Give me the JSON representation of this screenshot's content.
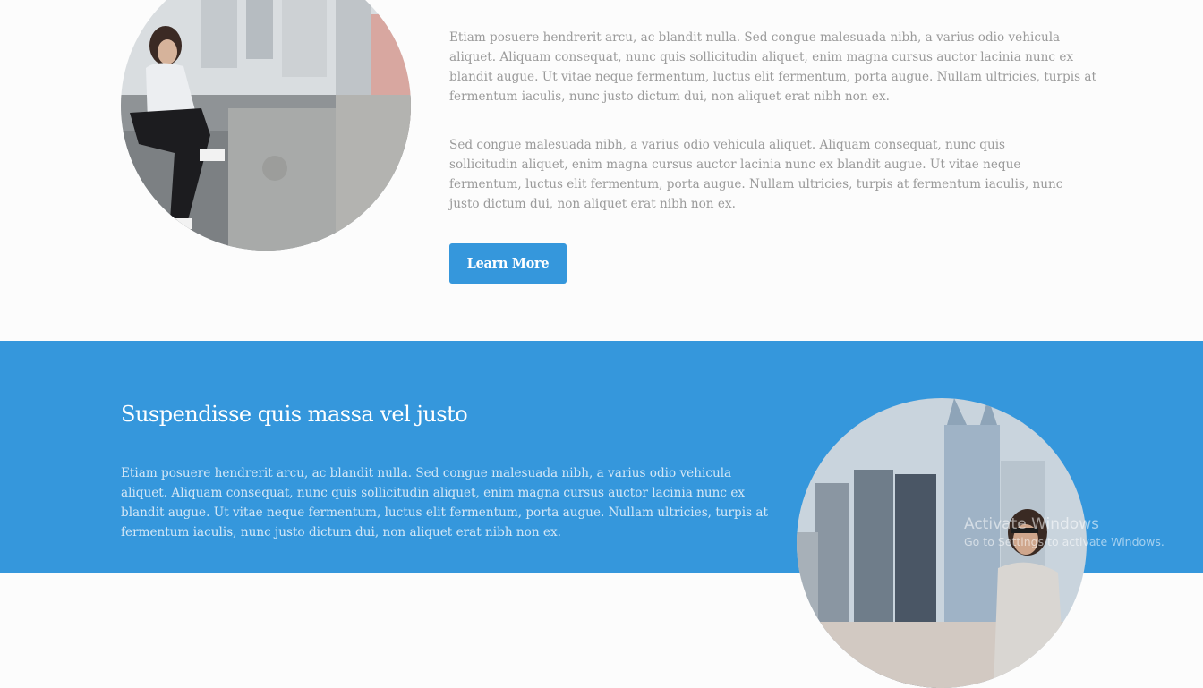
{
  "top_section": {
    "paragraphs": [
      "Etiam posuere hendrerit arcu, ac blandit nulla. Sed congue malesuada nibh, a varius odio vehicula aliquet. Aliquam consequat, nunc quis sollicitudin aliquet, enim magna cursus auctor lacinia nunc ex blandit augue. Ut vitae neque fermentum, luctus elit fermentum, porta augue. Nullam ultricies, turpis at fermentum iaculis, nunc justo dictum dui, non aliquet erat nibh non ex.",
      "Sed congue malesuada nibh, a varius odio vehicula aliquet. Aliquam consequat, nunc quis sollicitudin aliquet, enim magna cursus auctor lacinia nunc ex blandit augue. Ut vitae neque fermentum, luctus elit fermentum, porta augue. Nullam ultricies, turpis at fermentum iaculis, nunc justo dictum dui, non aliquet erat nibh non ex."
    ],
    "button_label": "Learn More"
  },
  "blue_section": {
    "heading": "Suspendisse quis massa vel justo",
    "paragraph": "Etiam posuere hendrerit arcu, ac blandit nulla. Sed congue malesuada nibh, a varius odio vehicula aliquet. Aliquam consequat, nunc quis sollicitudin aliquet, enim magna cursus auctor lacinia nunc ex blandit augue. Ut vitae neque fermentum, luctus elit fermentum, porta augue. Nullam ultricies, turpis at fermentum iaculis, nunc justo dictum dui, non aliquet erat nibh non ex."
  },
  "watermark": {
    "title": "Activate Windows",
    "subtitle": "Go to Settings to activate Windows."
  },
  "colors": {
    "page_background": "#fcfcfc",
    "accent_blue": "#3597dc",
    "body_text": "#9a9a9a",
    "button_text": "#ffffff"
  }
}
